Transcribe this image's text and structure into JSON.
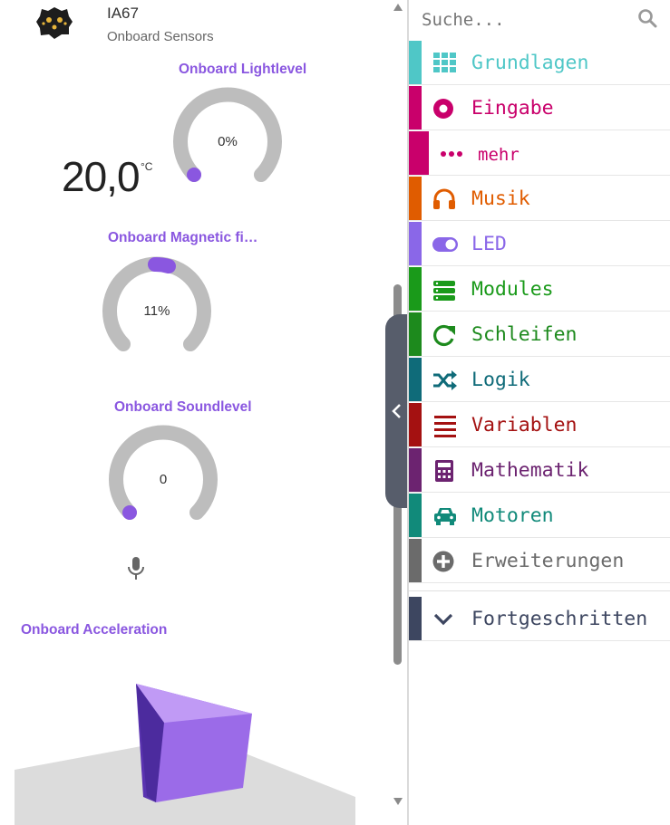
{
  "simulator": {
    "board_name": "IA67",
    "panel_subtitle": "Onboard Sensors",
    "temperature": {
      "value": "20,0",
      "unit": "°C"
    },
    "gauges": [
      {
        "title": "Onboard Lightlevel",
        "value": "0%",
        "level": 0
      },
      {
        "title": "Onboard Magnetic fi…",
        "value": "11%",
        "level": 0.11
      },
      {
        "title": "Onboard Soundlevel",
        "value": "0",
        "level": 0
      }
    ],
    "acceleration_title": "Onboard Acceleration"
  },
  "toolbox": {
    "search_placeholder": "Suche...",
    "categories": [
      {
        "label": "Grundlagen",
        "color": "#4fc7c7",
        "icon": "grid-icon"
      },
      {
        "label": "Eingabe",
        "color": "#c9006b",
        "icon": "target-circle-icon"
      },
      {
        "label": "mehr",
        "color": "#c9006b",
        "icon": "more-dots-icon"
      },
      {
        "label": "Musik",
        "color": "#e05c00",
        "icon": "headphones-icon"
      },
      {
        "label": "LED",
        "color": "#8a67e8",
        "icon": "toggle-icon"
      },
      {
        "label": "Modules",
        "color": "#1a9a1a",
        "icon": "stack-icon"
      },
      {
        "label": "Schleifen",
        "color": "#1d8a1d",
        "icon": "refresh-icon"
      },
      {
        "label": "Logik",
        "color": "#0f6b79",
        "icon": "shuffle-icon"
      },
      {
        "label": "Variablen",
        "color": "#a41111",
        "icon": "list-lines-icon"
      },
      {
        "label": "Mathematik",
        "color": "#6c2370",
        "icon": "calculator-icon"
      },
      {
        "label": "Motoren",
        "color": "#118a7a",
        "icon": "car-icon"
      },
      {
        "label": "Erweiterungen",
        "color": "#6b6b6b",
        "icon": "plus-circle-icon"
      },
      {
        "label": "Fortgeschritten",
        "color": "#3d4660",
        "icon": "chevron-down-icon"
      }
    ]
  }
}
